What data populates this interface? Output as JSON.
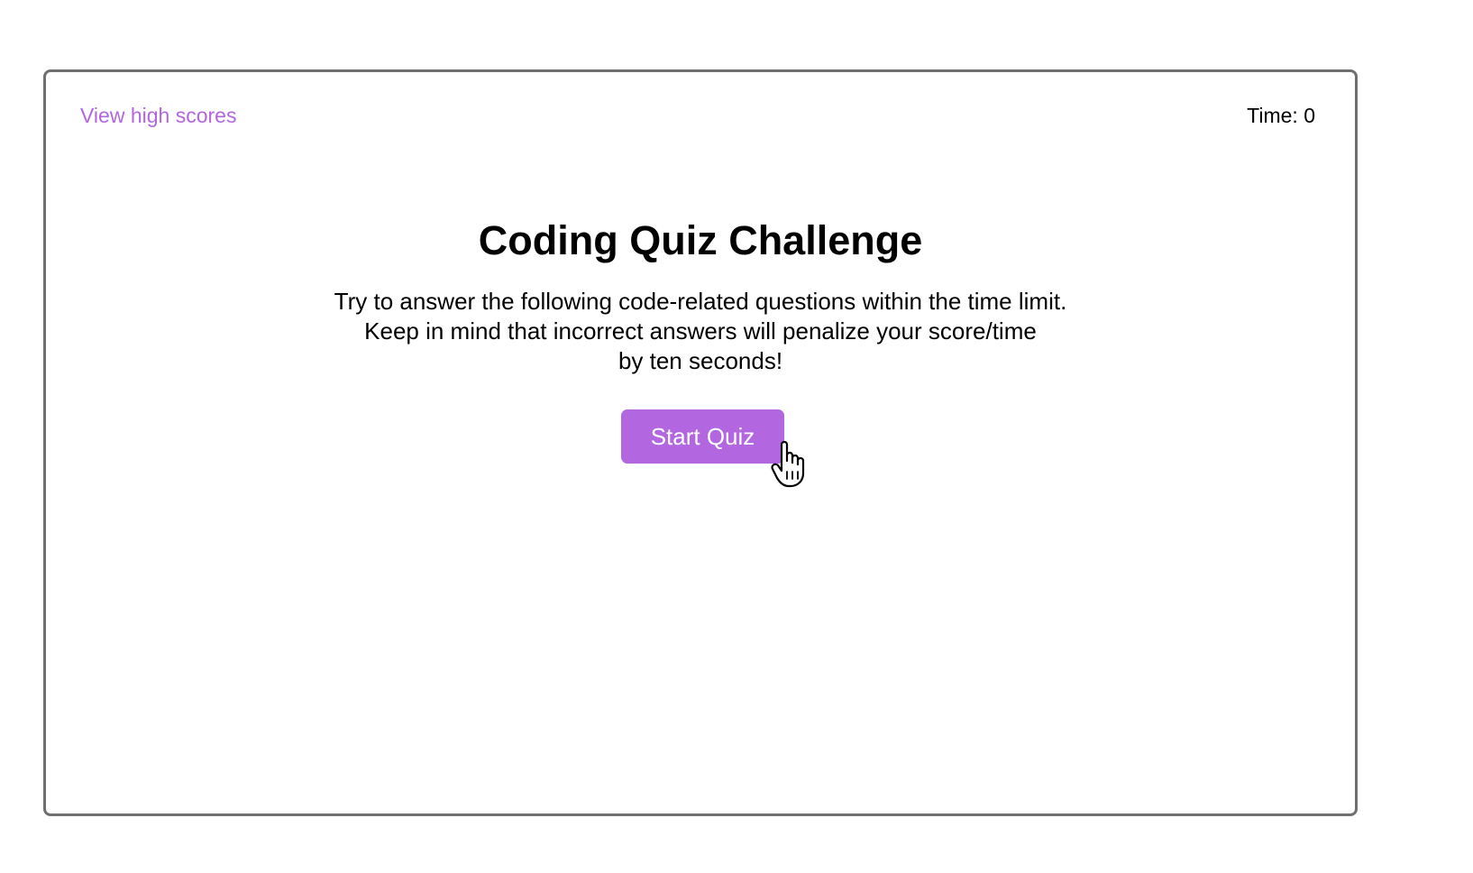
{
  "header": {
    "high_scores_link": "View high scores",
    "timer_label": "Time:",
    "timer_value": "0"
  },
  "main": {
    "title": "Coding Quiz Challenge",
    "description_lines": [
      "Try to answer the following code-related questions within the time limit.",
      "Keep in mind that incorrect answers will penalize your score/time",
      "by ten seconds!"
    ],
    "start_button_label": "Start Quiz"
  },
  "icons": {
    "cursor": "hand-pointer-icon"
  },
  "colors": {
    "accent": "#b266e0",
    "frame_border": "#6f6f6f",
    "text": "#000000",
    "background": "#ffffff"
  }
}
